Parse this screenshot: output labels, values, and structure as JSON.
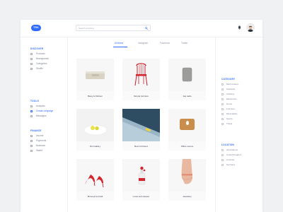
{
  "app": {
    "logo_text": "TRK",
    "accent": "#2f6bff"
  },
  "search": {
    "placeholder": "Search anything",
    "value": ""
  },
  "sidebar": {
    "sections": [
      {
        "title": "DISCOVER",
        "items": [
          {
            "label": "Products",
            "icon": "box-icon"
          },
          {
            "label": "Brandpanels",
            "icon": "grid-icon"
          },
          {
            "label": "Categories",
            "icon": "tag-icon"
          },
          {
            "label": "Shuffle",
            "icon": "shuffle-icon"
          }
        ]
      },
      {
        "title": "TOOLS",
        "items": [
          {
            "label": "Analytics",
            "icon": "chart-icon"
          },
          {
            "label": "Create campaign",
            "icon": "heart-icon",
            "active": true
          },
          {
            "label": "Messages",
            "icon": "message-icon"
          }
        ]
      },
      {
        "title": "FINANCE",
        "items": [
          {
            "label": "Income",
            "icon": "income-icon"
          },
          {
            "label": "Payments",
            "icon": "card-icon"
          },
          {
            "label": "Business",
            "icon": "briefcase-icon"
          },
          {
            "label": "Wallet",
            "icon": "wallet-icon"
          }
        ]
      }
    ]
  },
  "tabs": [
    {
      "label": "All items",
      "active": true
    },
    {
      "label": "Instagram"
    },
    {
      "label": "Facebook"
    },
    {
      "label": "Twitter"
    }
  ],
  "products": [
    {
      "label": "Bang & Olufsen",
      "image": "speaker"
    },
    {
      "label": "Simple furniture",
      "image": "red-chair"
    },
    {
      "label": "Jas radio",
      "image": "grey-speaker"
    },
    {
      "label": "Dot Gallery",
      "image": "plate-fruit"
    },
    {
      "label": "Best Art blend",
      "image": "blue-art"
    },
    {
      "label": "Office source",
      "image": "mouse-pad"
    },
    {
      "label": "Mimosa for Dolli",
      "image": "red-heels"
    },
    {
      "label": "Lotus soft cleaner",
      "image": "cosmetic-bottle"
    },
    {
      "label": "Jewellery",
      "image": "elbow"
    }
  ],
  "filters": {
    "category": {
      "title": "CATEGORY",
      "options": [
        "Most trusted",
        "Featured",
        "Clothing",
        "Electronics",
        "Home",
        "Furniture",
        "Minimalistic",
        "Sports",
        "Travel"
      ]
    },
    "location": {
      "title": "LOCATION",
      "options": [
        "All locations",
        "United Kingdom",
        "America",
        "Germany"
      ]
    }
  }
}
